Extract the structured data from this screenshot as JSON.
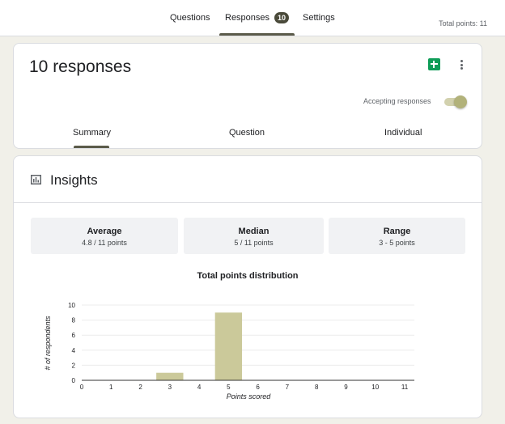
{
  "nav": {
    "tabs": [
      {
        "label": "Questions"
      },
      {
        "label": "Responses",
        "badge": "10"
      },
      {
        "label": "Settings"
      }
    ],
    "total_points": "Total points: 11"
  },
  "summary_card": {
    "title": "10 responses",
    "sheets_icon": "google-sheets-icon",
    "more_icon": "more-vert-icon",
    "accepting_label": "Accepting responses",
    "accepting": true,
    "tabs": [
      {
        "label": "Summary",
        "selected": true
      },
      {
        "label": "Question"
      },
      {
        "label": "Individual"
      }
    ]
  },
  "insights": {
    "icon": "bar-chart-icon",
    "title": "Insights",
    "stats": [
      {
        "label": "Average",
        "value": "4.8 / 11 points"
      },
      {
        "label": "Median",
        "value": "5 / 11 points"
      },
      {
        "label": "Range",
        "value": "3 - 5 points"
      }
    ]
  },
  "colors": {
    "accent": "#5b5b4a",
    "bar": "#cbc99a",
    "toggle_knob": "#b2b27a",
    "sheets": "#0f9d58"
  },
  "chart_data": {
    "type": "bar",
    "title": "Total points distribution",
    "xlabel": "Points scored",
    "ylabel": "# of respondents",
    "categories": [
      "0",
      "1",
      "2",
      "3",
      "4",
      "5",
      "6",
      "7",
      "8",
      "9",
      "10",
      "11"
    ],
    "values": [
      0,
      0,
      0,
      1,
      0,
      9,
      0,
      0,
      0,
      0,
      0,
      0
    ],
    "ylim": [
      0,
      10
    ],
    "yticks": [
      0,
      2,
      4,
      6,
      8,
      10
    ],
    "grid": true
  }
}
